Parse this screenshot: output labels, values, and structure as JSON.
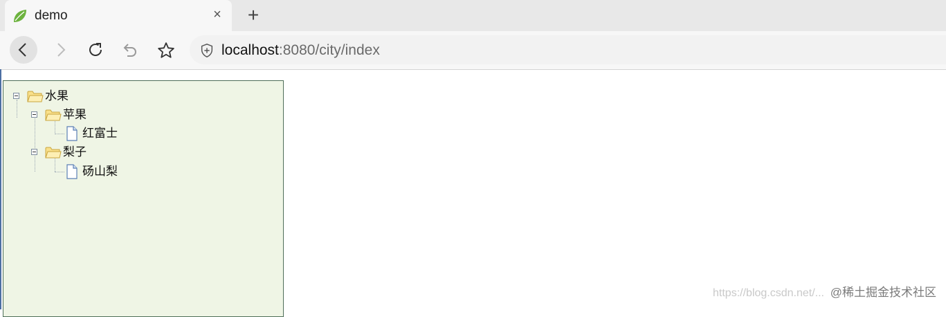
{
  "browser": {
    "tab_title": "demo",
    "tab_close_glyph": "×",
    "new_tab_glyph": "+",
    "url_host": "localhost",
    "url_path": ":8080/city/index",
    "favicon": "spring-leaf-icon",
    "toolbar_icons": [
      "back-icon",
      "forward-icon",
      "reload-icon",
      "undo-icon",
      "star-icon",
      "shield-icon"
    ]
  },
  "tree": {
    "nodes": [
      {
        "label": "水果",
        "type": "folder",
        "expanded": true,
        "level": 0
      },
      {
        "label": "苹果",
        "type": "folder",
        "expanded": true,
        "level": 1
      },
      {
        "label": "红富士",
        "type": "file",
        "level": 2
      },
      {
        "label": "梨子",
        "type": "folder",
        "expanded": true,
        "level": 1
      },
      {
        "label": "砀山梨",
        "type": "file",
        "level": 2
      }
    ]
  },
  "watermark": {
    "url": "https://blog.csdn.net/...",
    "text": "@稀土掘金技术社区"
  },
  "colors": {
    "tree_background": "#eff5e5",
    "tree_border": "#4e6e58",
    "folder_fill": "#f9e08a",
    "leaf_green": "#6db33f"
  }
}
